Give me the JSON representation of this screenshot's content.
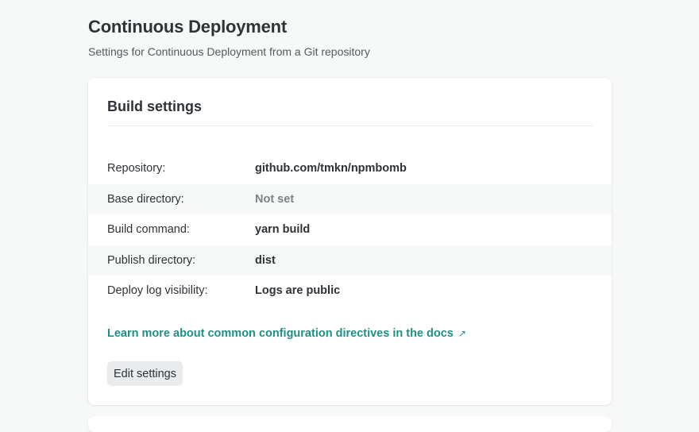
{
  "header": {
    "title": "Continuous Deployment",
    "subtitle": "Settings for Continuous Deployment from a Git repository"
  },
  "build_settings": {
    "title": "Build settings",
    "rows": [
      {
        "label": "Repository:",
        "value": "github.com/tmkn/npmbomb"
      },
      {
        "label": "Base directory:",
        "value": "Not set"
      },
      {
        "label": "Build command:",
        "value": "yarn build"
      },
      {
        "label": "Publish directory:",
        "value": "dist"
      },
      {
        "label": "Deploy log visibility:",
        "value": "Logs are public"
      }
    ],
    "docs_link": "Learn more about common configuration directives in the docs",
    "docs_link_icon": "external-link-icon",
    "edit_button": "Edit settings"
  },
  "colors": {
    "background": "#f7f8f8",
    "link": "#1f8f85",
    "muted_value": "#7b8187"
  }
}
